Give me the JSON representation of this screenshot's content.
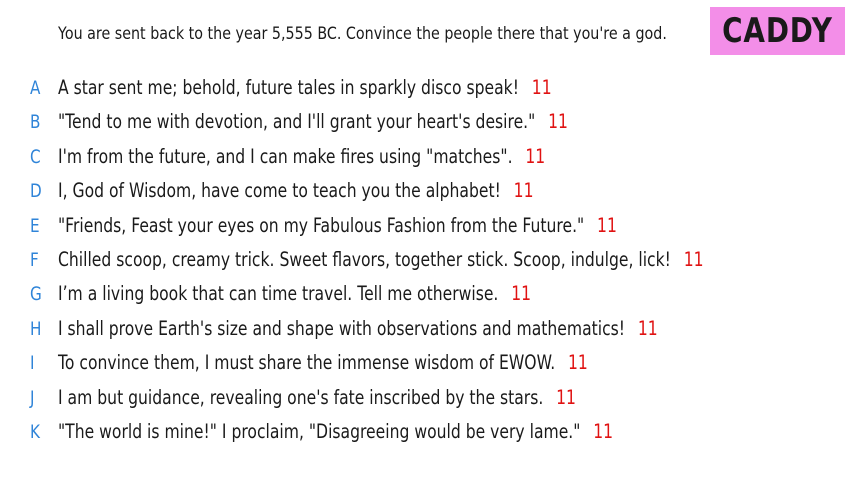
{
  "prompt": "You are sent back to the year 5,555 BC. Convince the people there that you're a god.",
  "badge": {
    "label": "CADDY",
    "color": "#f38ee8"
  },
  "colors": {
    "letter": "#2f84d8",
    "count": "#e01212",
    "text": "#1a1a1a"
  },
  "responses": [
    {
      "letter": "A",
      "text": "A star sent me; behold, future tales in sparkly disco speak!",
      "count": "11"
    },
    {
      "letter": "B",
      "text": "\"Tend to me with devotion, and I'll grant your heart's desire.\"",
      "count": "11"
    },
    {
      "letter": "C",
      "text": "I'm from the future, and I can make fires using \"matches\".",
      "count": "11"
    },
    {
      "letter": "D",
      "text": "I, God of Wisdom, have come to teach you the alphabet!",
      "count": "11"
    },
    {
      "letter": "E",
      "text": "\"Friends, Feast your eyes on my Fabulous Fashion from the Future.\"",
      "count": "11"
    },
    {
      "letter": "F",
      "text": "Chilled scoop, creamy trick. Sweet flavors, together stick. Scoop, indulge, lick!",
      "count": "11"
    },
    {
      "letter": "G",
      "text": "I’m a living book that can time travel. Tell me otherwise.",
      "count": "11"
    },
    {
      "letter": "H",
      "text": "I shall prove Earth's size and shape with observations and mathematics!",
      "count": "11"
    },
    {
      "letter": "I",
      "text": "To convince them, I must share the immense wisdom of EWOW.",
      "count": "11"
    },
    {
      "letter": "J",
      "text": "I am but guidance, revealing one's fate inscribed by the stars.",
      "count": "11"
    },
    {
      "letter": "K",
      "text": "\"The world is mine!\" I proclaim, \"Disagreeing would be very lame.\"",
      "count": "11"
    }
  ]
}
